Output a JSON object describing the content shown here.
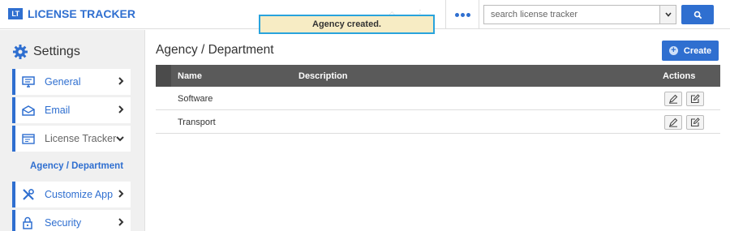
{
  "app": {
    "logo_abbr": "LT",
    "title": "LICENSE TRACKER"
  },
  "toast": {
    "message": "Agency created."
  },
  "search": {
    "placeholder": "search license tracker"
  },
  "sidebar": {
    "title": "Settings",
    "items": [
      {
        "label": "General",
        "icon": "monitor-icon",
        "expanded": false
      },
      {
        "label": "Email",
        "icon": "envelope-icon",
        "expanded": false
      },
      {
        "label": "License Tracker",
        "icon": "window-icon",
        "expanded": true
      },
      {
        "label": "Customize App",
        "icon": "tools-icon",
        "expanded": false
      },
      {
        "label": "Security",
        "icon": "lock-icon",
        "expanded": false
      }
    ],
    "active_subitem": "Agency / Department"
  },
  "main": {
    "title": "Agency / Department",
    "create_label": "Create",
    "columns": {
      "name": "Name",
      "description": "Description",
      "actions": "Actions"
    },
    "rows": [
      {
        "name": "Software",
        "description": ""
      },
      {
        "name": "Transport",
        "description": ""
      }
    ]
  },
  "colors": {
    "accent": "#2f6fd0",
    "toast_bg": "#f7ecc4",
    "toast_border": "#29a3dc",
    "grid_header": "#5a5a5a"
  }
}
